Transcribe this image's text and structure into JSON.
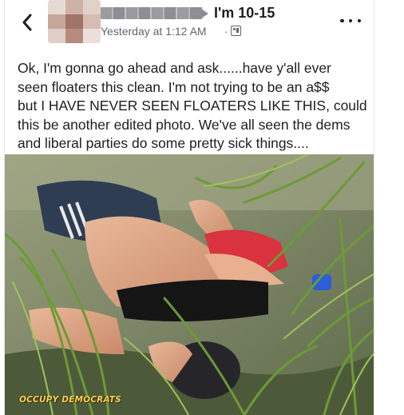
{
  "header": {
    "back_icon": "chevron-left-icon",
    "group_name": "I'm 10-15",
    "timestamp": "Yesterday at 1:12 AM",
    "separator": "·",
    "audience_icon": "group-audience-icon",
    "more_icon": "more-options-icon"
  },
  "post": {
    "text": "Ok, I'm gonna go ahead and ask......have y'all ever\nseen floaters this clean.  I'm not trying to be an a$$\nbut I HAVE NEVER SEEN FLOATERS LIKE THIS,  could\nthis be another edited photo.  We've all seen the dems\nand liberal parties do some pretty sick things...."
  },
  "photo": {
    "watermark": "OCCUPY DEMOCRATS"
  },
  "colors": {
    "text_primary": "#1c1e21",
    "text_secondary": "#606770",
    "watermark": "#f2d25a"
  }
}
